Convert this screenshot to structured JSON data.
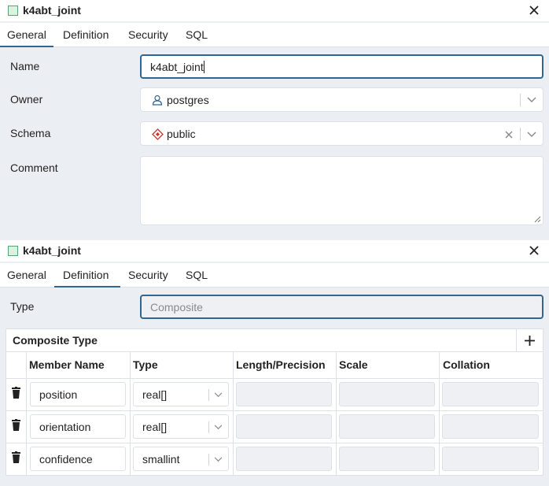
{
  "dialog1": {
    "title": "k4abt_joint",
    "tabs": [
      "General",
      "Definition",
      "Security",
      "SQL"
    ],
    "active_tab": "General",
    "name": {
      "label": "Name",
      "value": "k4abt_joint"
    },
    "owner": {
      "label": "Owner",
      "value": "postgres"
    },
    "schema": {
      "label": "Schema",
      "value": "public"
    },
    "comment": {
      "label": "Comment",
      "value": ""
    }
  },
  "dialog2": {
    "title": "k4abt_joint",
    "tabs": [
      "General",
      "Definition",
      "Security",
      "SQL"
    ],
    "active_tab": "Definition",
    "type": {
      "label": "Type",
      "placeholder": "Composite"
    },
    "composite": {
      "title": "Composite Type",
      "columns": [
        "Member Name",
        "Type",
        "Length/Precision",
        "Scale",
        "Collation"
      ],
      "rows": [
        {
          "member": "position",
          "type": "real[]"
        },
        {
          "member": "orientation",
          "type": "real[]"
        },
        {
          "member": "confidence",
          "type": "smallint"
        }
      ]
    }
  },
  "colors": {
    "accent": "#326690",
    "bg": "#ebeef3",
    "border": "#dde0e6"
  }
}
